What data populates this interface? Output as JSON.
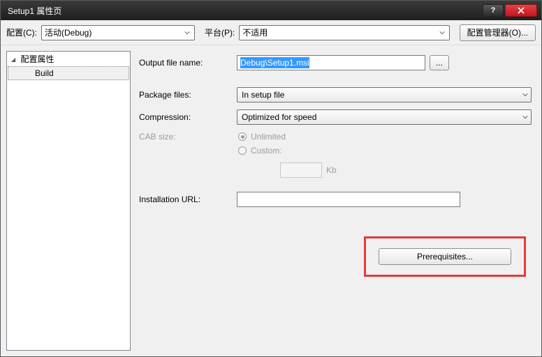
{
  "window": {
    "title": "Setup1 属性页"
  },
  "toolbar": {
    "config_label": "配置(C):",
    "config_value": "活动(Debug)",
    "platform_label": "平台(P):",
    "platform_value": "不适用",
    "config_manager_label": "配置管理器(O)..."
  },
  "tree": {
    "root": "配置属性",
    "child": "Build"
  },
  "form": {
    "output_file_label": "Output file name:",
    "output_file_value": "Debug\\Setup1.msi",
    "browse_label": "...",
    "package_files_label": "Package files:",
    "package_files_value": "In setup file",
    "compression_label": "Compression:",
    "compression_value": "Optimized for speed",
    "cab_size_label": "CAB size:",
    "cab_unlimited": "Unlimited",
    "cab_custom": "Custom:",
    "kb_label": "Kb",
    "installation_url_label": "Installation URL:",
    "prerequisites_label": "Prerequisites..."
  }
}
